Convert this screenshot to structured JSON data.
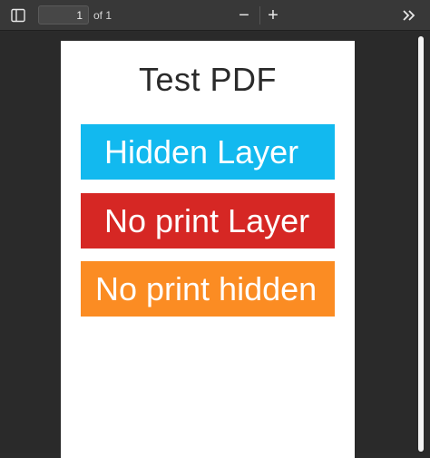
{
  "toolbar": {
    "sidebar_icon": "sidebar-toggle-icon",
    "page_number": "1",
    "page_total": "of 1",
    "zoom_out_label": "−",
    "zoom_in_label": "+",
    "more_icon": "double-chevron-right-icon"
  },
  "document": {
    "title": "Test PDF",
    "layers": [
      {
        "label": "Hidden Layer",
        "color": "#12b9ef"
      },
      {
        "label": "No print Layer",
        "color": "#d62724"
      },
      {
        "label": "No print hidden",
        "color": "#fb8c23"
      }
    ]
  }
}
